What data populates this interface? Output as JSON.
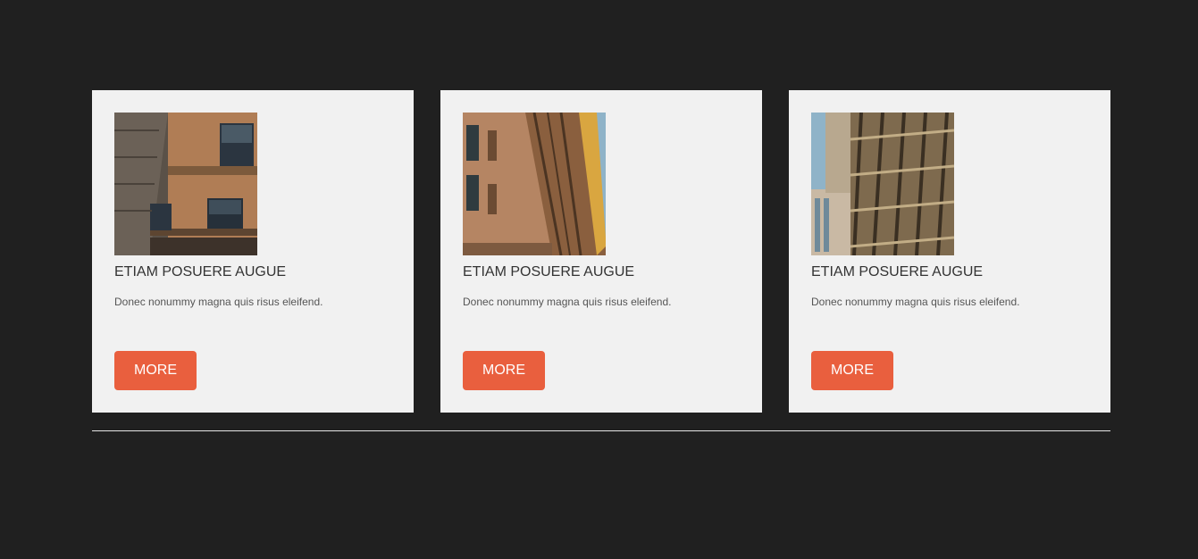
{
  "colors": {
    "page_background": "#202020",
    "card_background": "#f1f1f1",
    "button_background": "#e95f3e",
    "divider": "#e6e6e6"
  },
  "cards": [
    {
      "image": "building-photo",
      "title": "ETIAM POSUERE AUGUE",
      "text": "Donec nonummy magna quis risus eleifend.",
      "button": "MORE"
    },
    {
      "image": "building-photo",
      "title": "ETIAM POSUERE AUGUE",
      "text": "Donec nonummy magna quis risus eleifend.",
      "button": "MORE"
    },
    {
      "image": "building-photo",
      "title": "ETIAM POSUERE AUGUE",
      "text": "Donec nonummy magna quis risus eleifend.",
      "button": "MORE"
    }
  ]
}
